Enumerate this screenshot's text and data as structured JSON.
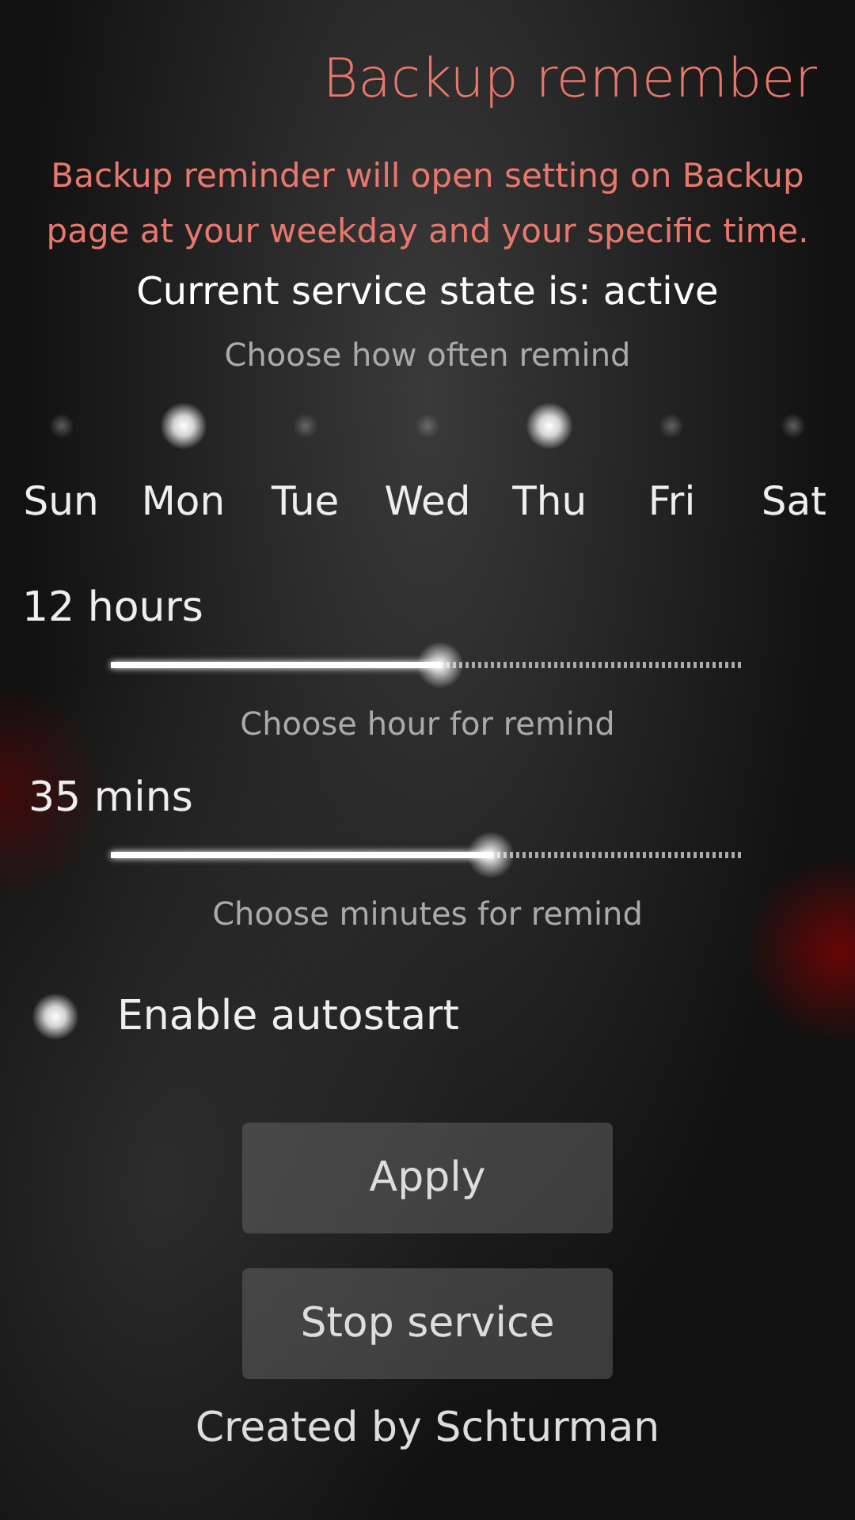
{
  "header": {
    "title": "Backup remember"
  },
  "description": "Backup reminder will open setting on Backup page at your weekday and your specific time.",
  "service_state": "Current service state is: active",
  "days_label": "Choose how often remind",
  "days": [
    {
      "label": "Sun",
      "checked": false
    },
    {
      "label": "Mon",
      "checked": true
    },
    {
      "label": "Tue",
      "checked": false
    },
    {
      "label": "Wed",
      "checked": false
    },
    {
      "label": "Thu",
      "checked": true
    },
    {
      "label": "Fri",
      "checked": false
    },
    {
      "label": "Sat",
      "checked": false
    }
  ],
  "sliders": [
    {
      "value": "12 hours",
      "label": "Choose hour for remind",
      "level": 0.52
    },
    {
      "value": "35 mins",
      "label": "Choose minutes for remind",
      "level": 0.6
    }
  ],
  "autostart": {
    "label": "Enable autostart",
    "checked": true
  },
  "buttons": [
    "Apply",
    "Stop service"
  ],
  "footer": "Created by Schturman"
}
